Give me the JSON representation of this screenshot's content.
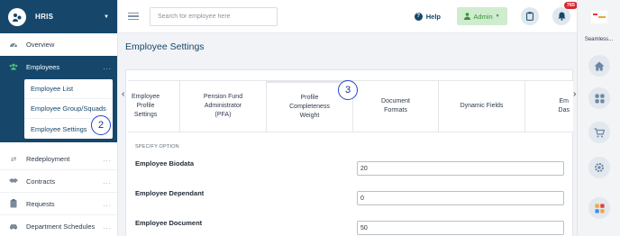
{
  "app": {
    "title": "HRIS"
  },
  "sidebar": {
    "items": [
      {
        "label": "Overview",
        "icon": "dashboard-icon"
      },
      {
        "label": "Employees",
        "icon": "users-icon",
        "dots": "..."
      },
      {
        "label": "Redeployment",
        "icon": "transfer-icon",
        "dots": "..."
      },
      {
        "label": "Contracts",
        "icon": "handshake-icon",
        "dots": "..."
      },
      {
        "label": "Requests",
        "icon": "clipboard-icon",
        "dots": "..."
      },
      {
        "label": "Department Schedules",
        "icon": "car-icon",
        "dots": "..."
      }
    ],
    "submenu": [
      "Employee List",
      "Employee Group/Squads",
      "Employee Settings"
    ]
  },
  "topbar": {
    "search_placeholder": "Search for employee here",
    "help_label": "Help",
    "admin_label": "Admin",
    "notification_count": "765"
  },
  "rail": {
    "label": "Seamless..."
  },
  "main": {
    "page_title": "Employee Settings",
    "tabs": [
      "Employee\nProfile\nSettings",
      "Pension Fund\nAdministrator\n(PFA)",
      "Profile\nCompleteness\nWeight",
      "Document\nFormats",
      "Dynamic Fields",
      "Em\nDas"
    ],
    "specify_option": "SPECIFY OPTION",
    "rows": [
      {
        "label": "Employee Biodata",
        "value": "20"
      },
      {
        "label": "Employee Dependant",
        "value": "0"
      },
      {
        "label": "Employee Document",
        "value": "50"
      }
    ]
  },
  "annotations": {
    "step2": "2",
    "step3": "3"
  },
  "colors": {
    "brand": "#16476b",
    "accent_green": "#4cc079",
    "badge_red": "#d9262f",
    "step_blue": "#2640d4"
  }
}
